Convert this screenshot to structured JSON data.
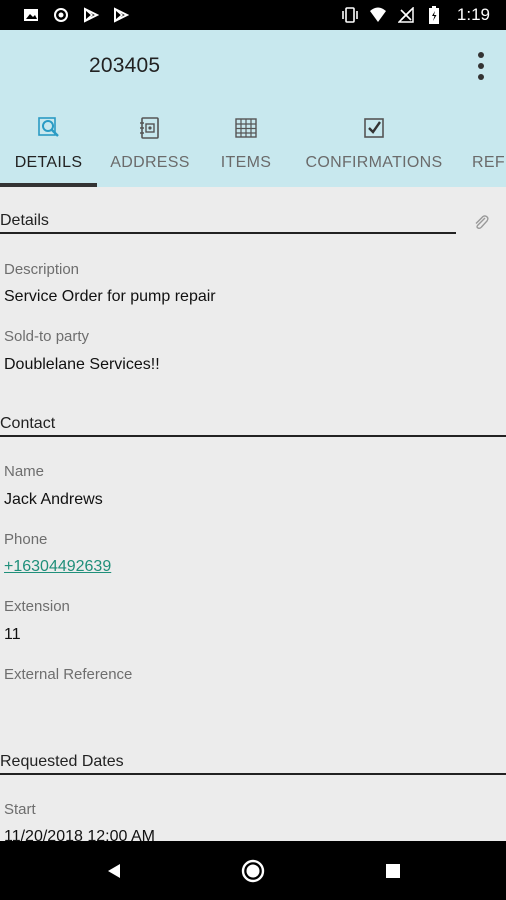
{
  "status_bar": {
    "time": "1:19",
    "left_icons": [
      "image-icon",
      "location-icon",
      "play-store-icon",
      "play-store-icon"
    ],
    "right_icons": [
      "vibrate-icon",
      "wifi-icon",
      "no-signal-icon",
      "battery-icon"
    ]
  },
  "app_bar": {
    "title": "203405",
    "tabs": [
      {
        "label": "DETAILS",
        "icon": "details-search-icon",
        "active": true
      },
      {
        "label": "ADDRESS",
        "icon": "address-book-icon",
        "active": false
      },
      {
        "label": "ITEMS",
        "icon": "grid-icon",
        "active": false
      },
      {
        "label": "CONFIRMATIONS",
        "icon": "checkbox-icon",
        "active": false
      },
      {
        "label": "REFE",
        "icon": "",
        "active": false
      }
    ]
  },
  "details": {
    "header": "Details",
    "description_label": "Description",
    "description_value": "Service Order for pump repair",
    "sold_to_label": "Sold-to party",
    "sold_to_value": "Doublelane Services!!"
  },
  "contact": {
    "header": "Contact",
    "name_label": "Name",
    "name_value": "Jack Andrews",
    "phone_label": "Phone",
    "phone_value": "+16304492639",
    "extension_label": "Extension",
    "extension_value": "11",
    "external_ref_label": "External Reference",
    "external_ref_value": ""
  },
  "requested_dates": {
    "header": "Requested Dates",
    "start_label": "Start",
    "start_value": "11/20/2018 12:00 AM"
  },
  "colors": {
    "app_bar_bg": "#c8e8ee",
    "active_icon": "#2a9bc4",
    "link": "#1f8f7a",
    "content_bg": "#ececec"
  }
}
